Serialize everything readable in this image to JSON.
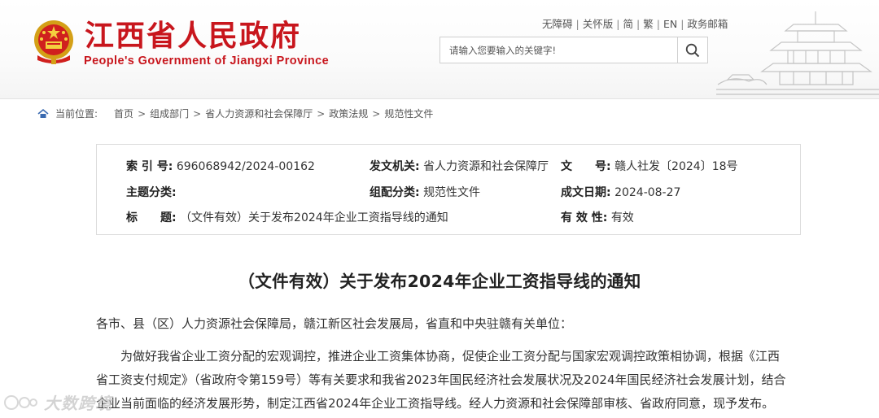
{
  "header": {
    "site_title": "江西省人民政府",
    "site_subtitle": "People's Government of Jiangxi Province",
    "brand_color": "#c8161d",
    "top_links": [
      "无障碍",
      "关怀版",
      "简",
      "繁",
      "EN",
      "政务邮箱"
    ],
    "search": {
      "placeholder": "请输入您要输入的关键字!",
      "icon": "search-icon"
    }
  },
  "breadcrumb": {
    "label": "当前位置:",
    "items": [
      "首页",
      "组成部门",
      "省人力资源和社会保障厅",
      "政策法规",
      "规范性文件"
    ]
  },
  "info": {
    "index_no": {
      "key": "索 引 号:",
      "value": "696068942/2024-00162"
    },
    "issuer": {
      "key": "发文机关:",
      "value": "省人力资源和社会保障厅"
    },
    "doc_no": {
      "key": "文　　号:",
      "value": "赣人社发〔2024〕18号"
    },
    "topic": {
      "key": "主题分类:",
      "value": ""
    },
    "category": {
      "key": "组配分类:",
      "value": "规范性文件"
    },
    "date": {
      "key": "成文日期:",
      "value": "2024-08-27"
    },
    "title": {
      "key": "标　　题:",
      "value": "（文件有效）关于发布2024年企业工资指导线的通知"
    },
    "validity": {
      "key": "有 效 性:",
      "value": "有效"
    }
  },
  "document": {
    "title": "（文件有效）关于发布2024年企业工资指导线的通知",
    "salutation": "各市、县（区）人力资源社会保障局，赣江新区社会发展局，省直和中央驻赣有关单位：",
    "paragraph1": "为做好我省企业工资分配的宏观调控，推进企业工资集体协商，促使企业工资分配与国家宏观调控政策相协调，根据《江西省工资支付规定》（省政府令第159号）等有关要求和我省2023年国民经济社会发展状况及2024年国民经济社会发展计划，结合企业当前面临的经济发展形势，制定江西省2024年企业工资指导线。经人力资源和社会保障部审核、省政府同意，现予发布。"
  },
  "watermark": {
    "text": "大数跨境"
  }
}
